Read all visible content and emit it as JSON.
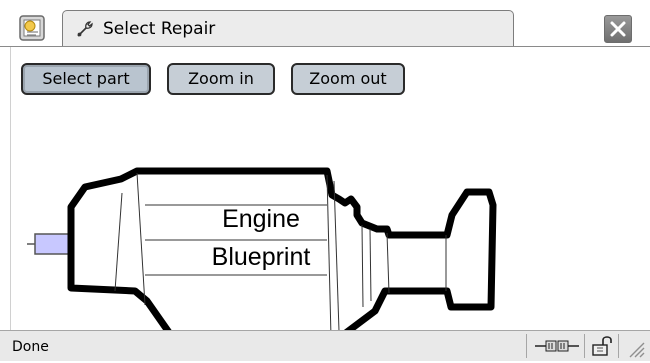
{
  "window": {
    "tab_title": "Select Repair",
    "browser_icon": "browser-icon",
    "tab_icon": "wrench-icon",
    "close_icon": "close-icon"
  },
  "toolbar": {
    "buttons": [
      {
        "label": "Select part",
        "pressed": true
      },
      {
        "label": "Zoom in",
        "pressed": false
      },
      {
        "label": "Zoom out",
        "pressed": false
      }
    ]
  },
  "diagram": {
    "label_line1": "Engine",
    "label_line2": "Blueprint",
    "highlight_color": "#c8c8ff"
  },
  "statusbar": {
    "text": "Done",
    "icons": [
      "connection-icon",
      "lock-icon",
      "resize-grip-icon"
    ]
  }
}
